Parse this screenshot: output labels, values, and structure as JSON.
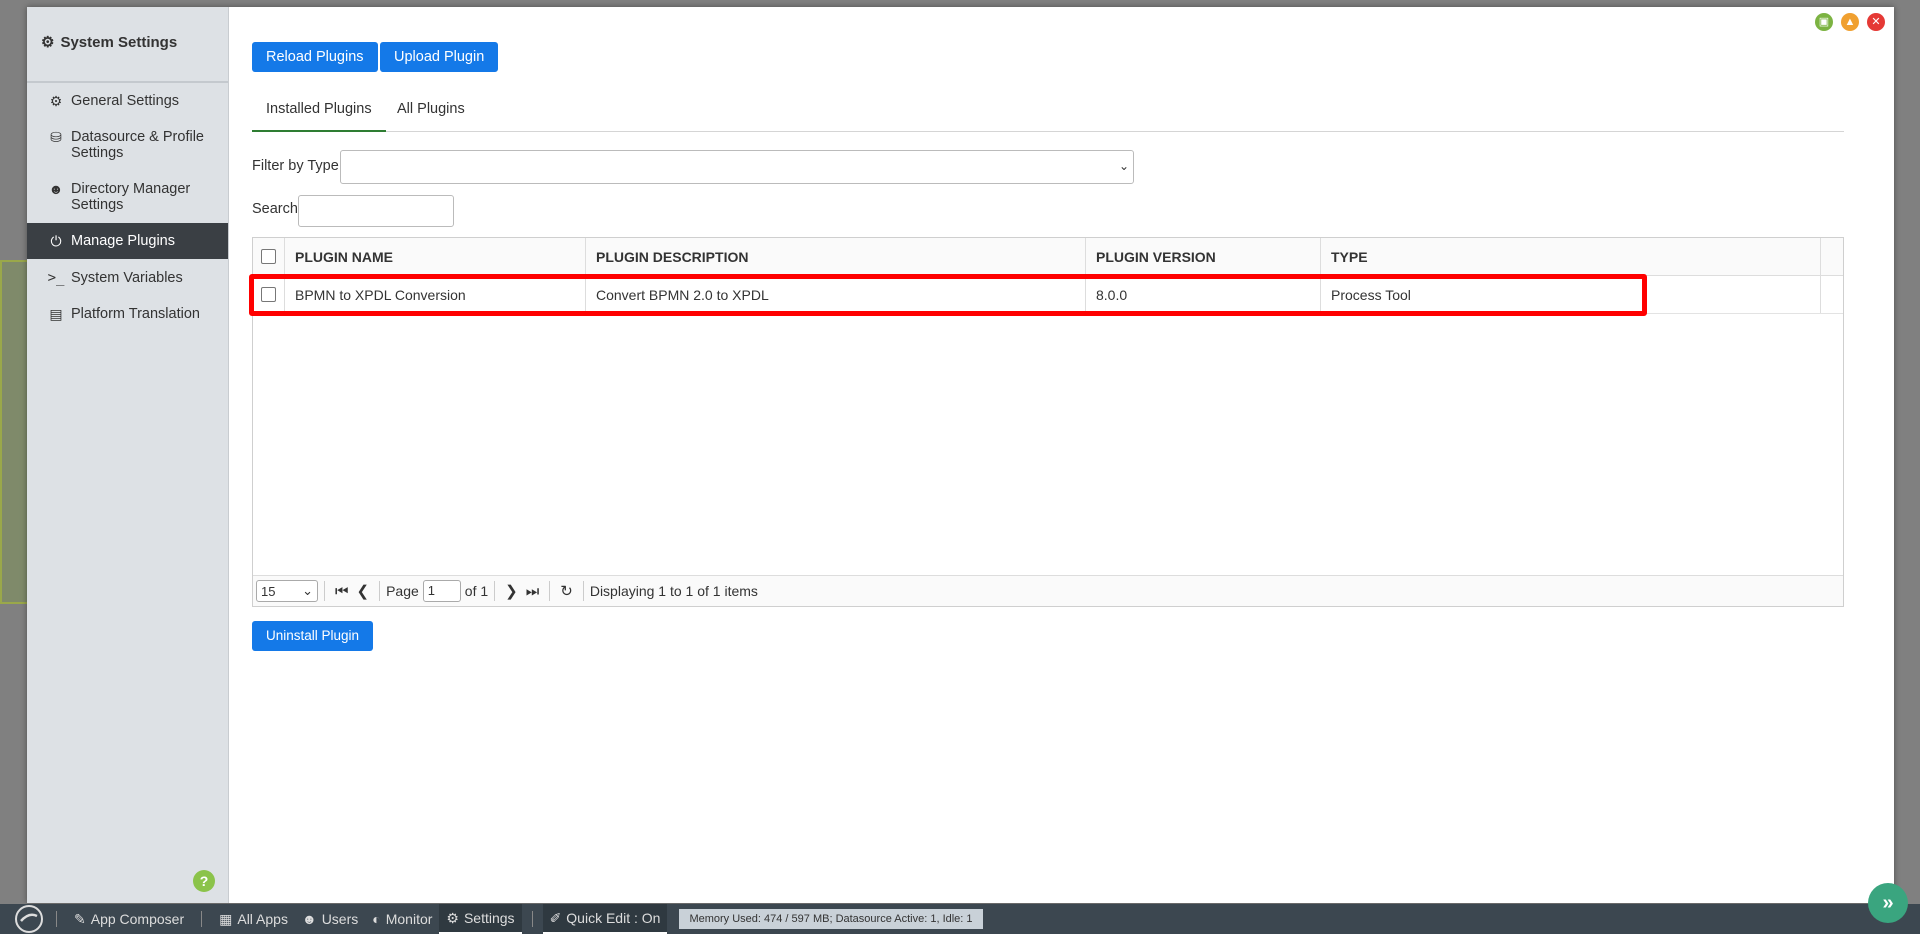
{
  "sidebar": {
    "title": "System Settings",
    "items": [
      {
        "label": "General Settings",
        "icon": "gear-icon"
      },
      {
        "label": "Datasource & Profile Settings",
        "icon": "database-icon"
      },
      {
        "label": "Directory Manager Settings",
        "icon": "users-icon"
      },
      {
        "label": "Manage Plugins",
        "icon": "plug-icon"
      },
      {
        "label": "System Variables",
        "icon": "terminal-icon"
      },
      {
        "label": "Platform Translation",
        "icon": "translate-icon"
      }
    ],
    "help": "?"
  },
  "toolbar": {
    "reload_label": "Reload Plugins",
    "upload_label": "Upload Plugin"
  },
  "tabs": [
    {
      "label": "Installed Plugins"
    },
    {
      "label": "All Plugins"
    }
  ],
  "filter": {
    "label": "Filter by Type",
    "value": ""
  },
  "search": {
    "label": "Search",
    "value": ""
  },
  "grid": {
    "columns": [
      "PLUGIN NAME",
      "PLUGIN DESCRIPTION",
      "PLUGIN VERSION",
      "TYPE"
    ],
    "rows": [
      {
        "name": "BPMN to XPDL Conversion",
        "description": "Convert BPMN 2.0 to XPDL",
        "version": "8.0.0",
        "type": "Process Tool"
      }
    ]
  },
  "pager": {
    "page_size": "15",
    "page_label": "Page",
    "page": "1",
    "of_label": "of 1",
    "status": "Displaying 1 to 1 of 1 items"
  },
  "actions": {
    "uninstall_label": "Uninstall Plugin"
  },
  "taskbar": {
    "items": [
      {
        "label": "App Composer",
        "icon": "edit-icon"
      },
      {
        "label": "All Apps",
        "icon": "grid-icon"
      },
      {
        "label": "Users",
        "icon": "users-icon"
      },
      {
        "label": "Monitor",
        "icon": "dashboard-icon"
      },
      {
        "label": "Settings",
        "icon": "gear-icon"
      },
      {
        "label": "Quick Edit : On",
        "icon": "pencil-icon"
      }
    ],
    "memory": "Memory Used: 474 / 597 MB; Datasource Active: 1, Idle: 1"
  },
  "colors": {
    "primary_button": "#1479e8",
    "active_sidebar": "#3a3f44",
    "highlight": "#ff0000",
    "taskbar": "#3c4750"
  }
}
